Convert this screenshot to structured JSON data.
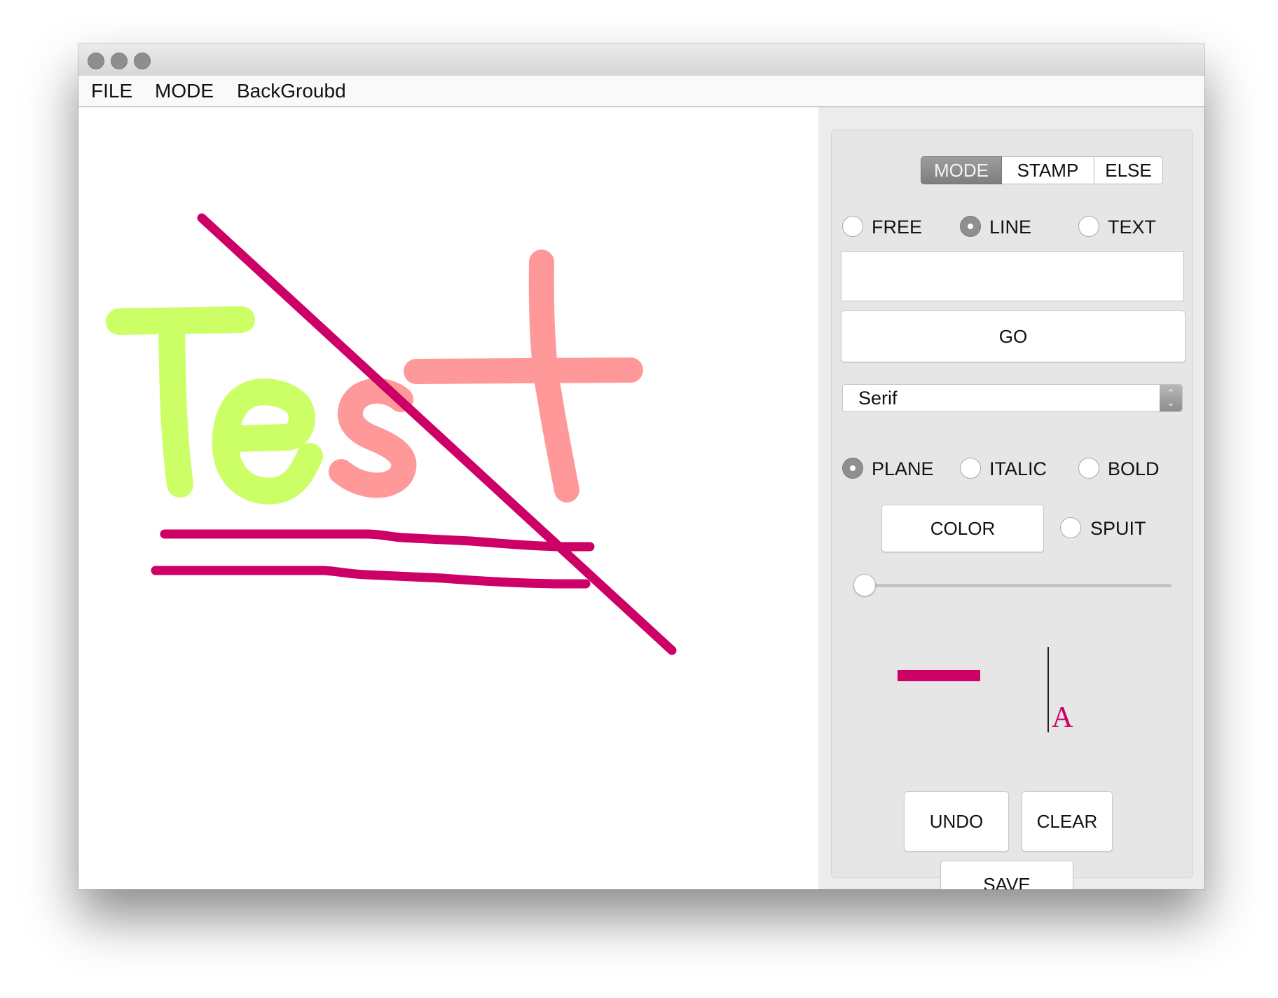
{
  "menu": {
    "file": "FILE",
    "mode": "MODE",
    "background": "BackGroubd"
  },
  "tabs": [
    {
      "label": "MODE",
      "active": true
    },
    {
      "label": "STAMP",
      "active": false
    },
    {
      "label": "ELSE",
      "active": false
    }
  ],
  "draw_mode": {
    "options": [
      "FREE",
      "LINE",
      "TEXT"
    ],
    "selected": "LINE"
  },
  "text_input": {
    "value": ""
  },
  "go_button": "GO",
  "font_select": {
    "value": "Serif"
  },
  "font_style": {
    "options": [
      "PLANE",
      "ITALIC",
      "BOLD"
    ],
    "selected": "PLANE"
  },
  "color_button": "COLOR",
  "spuit_label": "SPUIT",
  "stroke_width_slider": {
    "value": 0.0
  },
  "preview": {
    "glyph": "A",
    "color": "#cc0066"
  },
  "actions": {
    "undo": "UNDO",
    "clear": "CLEAR",
    "save": "SAVE"
  },
  "colors": {
    "current": "#cc0066",
    "lime": "#ccff66",
    "salmon": "#ff9999"
  }
}
